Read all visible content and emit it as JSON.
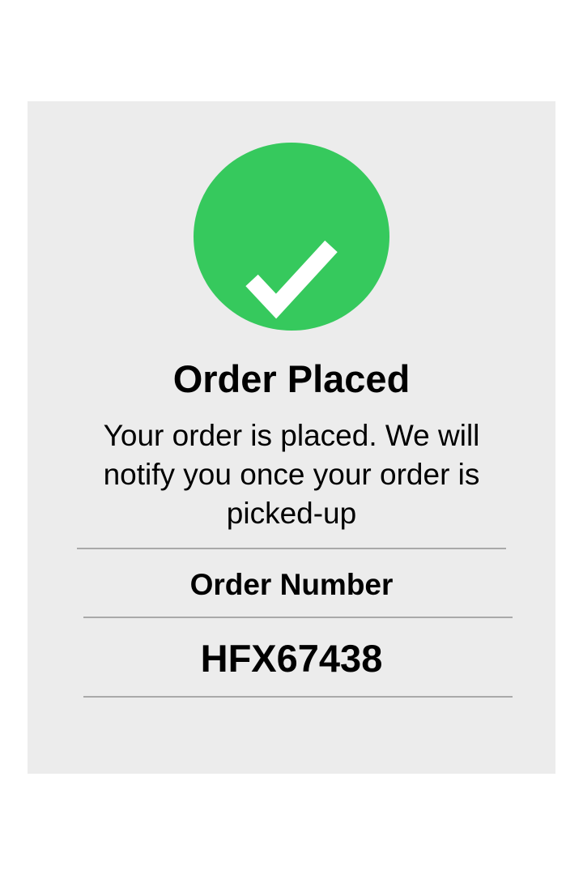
{
  "confirmation": {
    "icon": "checkmark-icon",
    "title": "Order Placed",
    "message": "Your order is placed. We will notify you once your order is picked-up",
    "order_number_label": "Order Number",
    "order_number": "HFX67438"
  },
  "colors": {
    "background": "#ffffff",
    "card": "#ececec",
    "success": "#36c95d",
    "check": "#ffffff",
    "divider": "#a9a9a9",
    "text": "#000000"
  }
}
